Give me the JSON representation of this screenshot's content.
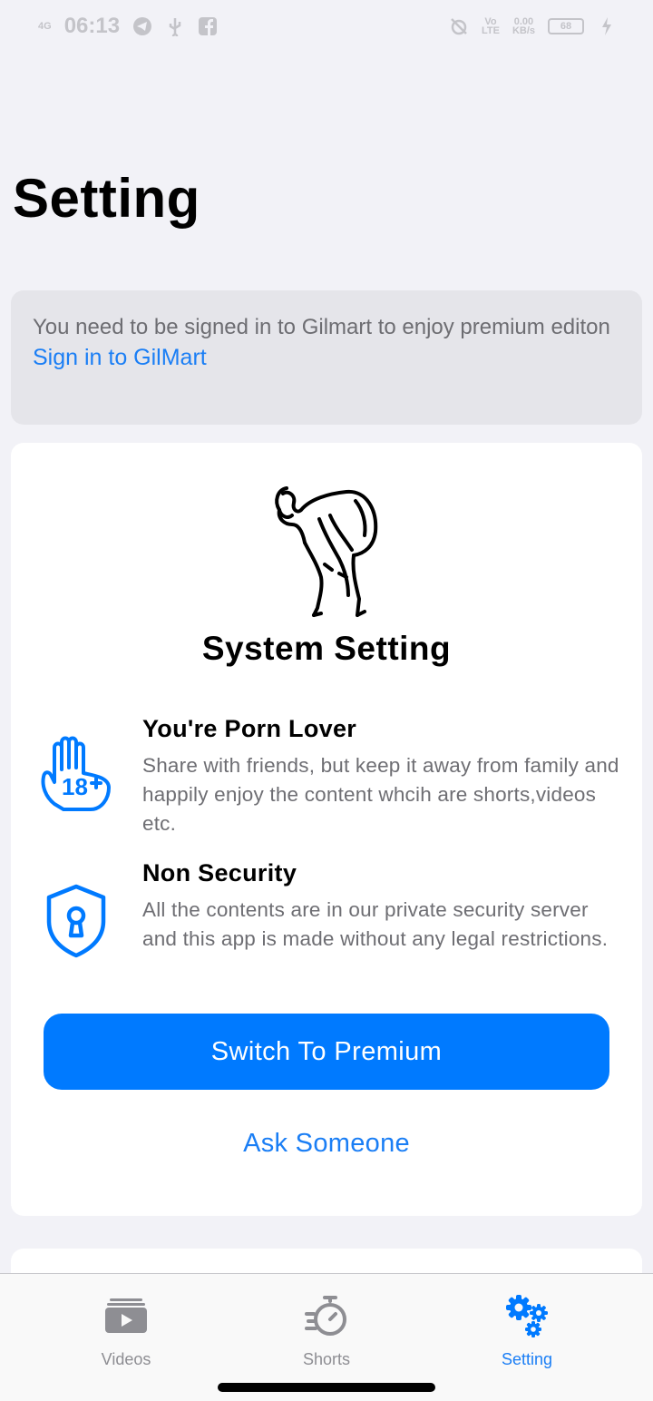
{
  "status_bar": {
    "network": "4G",
    "time": "06:13",
    "volte": "Vo",
    "lte": "LTE",
    "speed_value": "0.00",
    "speed_unit": "KB/s",
    "battery": "68"
  },
  "page_title": "Setting",
  "signin_card": {
    "message": "You need to be signed in to Gilmart to enjoy premium editon",
    "link": "Sign in to GilMart"
  },
  "main_card": {
    "title": "System Setting",
    "features": [
      {
        "icon": "hand-18-plus-icon",
        "title": "You're Porn Lover",
        "description": "Share with friends, but keep it away from family and happily enjoy the content whcih are shorts,videos etc."
      },
      {
        "icon": "shield-lock-icon",
        "title": "Non Security",
        "description": "All the contents are in our private security server and this app is made without any legal restrictions."
      }
    ],
    "primary_button": "Switch To Premium",
    "secondary_link": "Ask Someone"
  },
  "tab_bar": {
    "tabs": [
      {
        "label": "Videos",
        "icon": "videos-icon",
        "active": false
      },
      {
        "label": "Shorts",
        "icon": "stopwatch-icon",
        "active": false
      },
      {
        "label": "Setting",
        "icon": "gears-icon",
        "active": true
      }
    ]
  },
  "colors": {
    "accent": "#007aff",
    "link": "#1a7ef5",
    "background": "#f2f2f7",
    "inactive_tab": "#8e8e93"
  }
}
